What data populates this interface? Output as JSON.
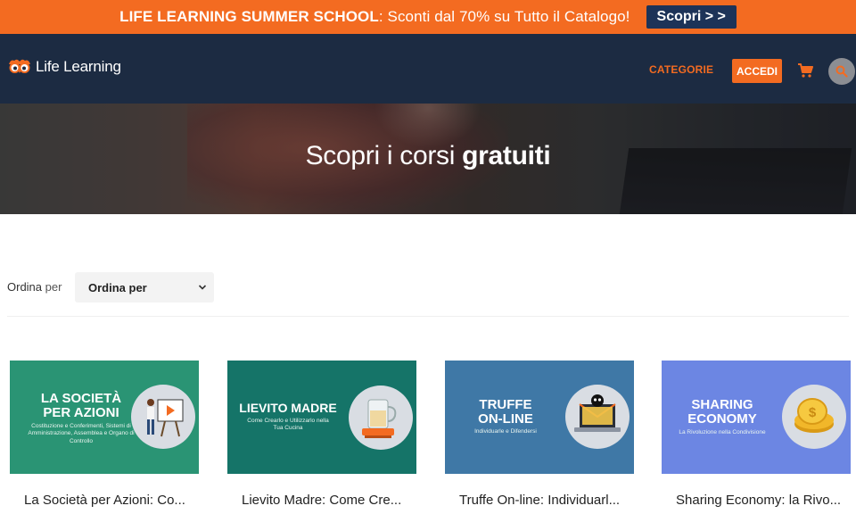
{
  "promo": {
    "bold": "LIFE LEARNING SUMMER SCHOOL",
    "text": ": Sconti dal 70% su Tutto il Catalogo!",
    "button": "Scopri > >"
  },
  "header": {
    "logo_text": "Life Learning",
    "nav_categories": "CATEGORIE",
    "nav_login": "ACCEDI"
  },
  "hero": {
    "title_regular": "Scopri i corsi ",
    "title_bold": "gratuiti"
  },
  "sort": {
    "label_strong": "Ordina",
    "label_rest": " per",
    "selected": "Ordina per"
  },
  "courses": [
    {
      "thumb_title_1": "LA SOCIETÀ",
      "thumb_title_2": "PER AZIONI",
      "thumb_sub": "Costituzione e Conferimenti, Sistemi di Amministrazione, Assemblea e Organo di Controllo",
      "title": "La Società per Azioni: Co...",
      "bg": "#2a9474",
      "icon": "presentation-board-icon"
    },
    {
      "thumb_title_1": "LIEVITO MADRE",
      "thumb_title_2": "",
      "thumb_sub": "Come Crearlo e Utilizzarlo nella Tua Cucina",
      "title": "Lievito Madre: Come Cre...",
      "bg": "#157468",
      "icon": "jar-icon"
    },
    {
      "thumb_title_1": "TRUFFE",
      "thumb_title_2": "ON-LINE",
      "thumb_sub": "Individuarle e Difendersi",
      "title": "Truffe On-line: Individuarl...",
      "bg": "#3f78a6",
      "icon": "laptop-skull-icon"
    },
    {
      "thumb_title_1": "SHARING",
      "thumb_title_2": "ECONOMY",
      "thumb_sub": "La Rivoluzione nella Condivisione",
      "title": "Sharing Economy: la Rivo...",
      "bg": "#6c86e3",
      "icon": "coins-icon"
    }
  ],
  "colors": {
    "accent": "#f36b21",
    "header_bg": "#1c2b42",
    "promo_button_bg": "#1d3358"
  }
}
